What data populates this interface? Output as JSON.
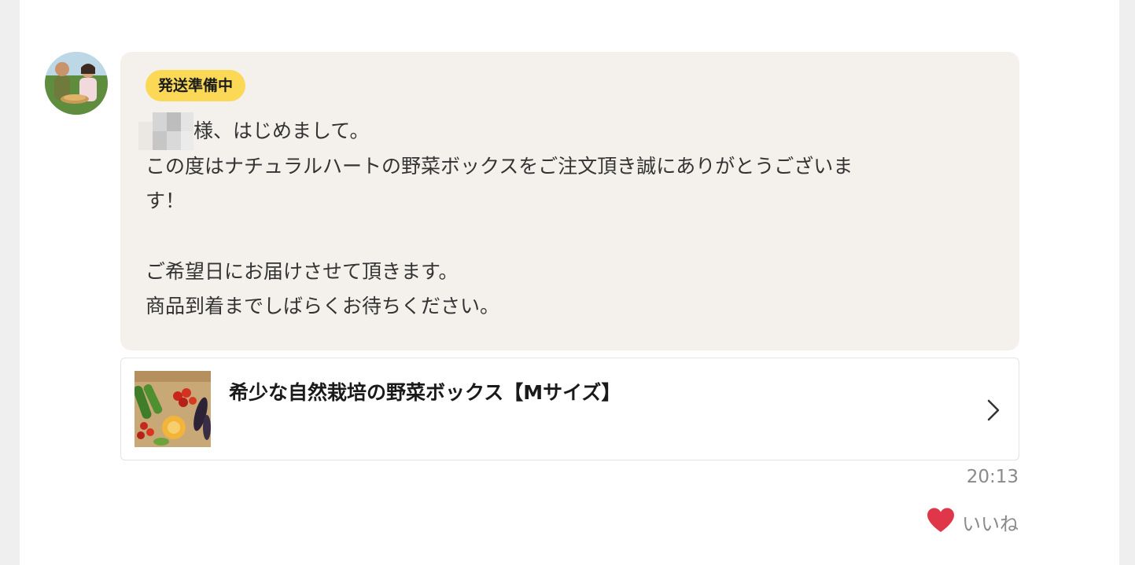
{
  "message": {
    "status_badge": "発送準備中",
    "greeting": "様、はじめまして。",
    "line1": "この度はナチュラルハートの野菜ボックスをご注文頂き誠にありがとうございま",
    "line2": "す！",
    "line3": "ご希望日にお届けさせて頂きます。",
    "line4": "商品到着までしばらくお待ちください。"
  },
  "product": {
    "title": "希少な自然栽培の野菜ボックス【Mサイズ】"
  },
  "timestamp": "20:13",
  "like": {
    "label": "いいね"
  },
  "colors": {
    "badge": "#fbd956",
    "bubble": "#f4f1ec",
    "heart": "#e0364a"
  },
  "icons": {
    "like": "heart-icon",
    "open": "chevron-right-icon"
  }
}
